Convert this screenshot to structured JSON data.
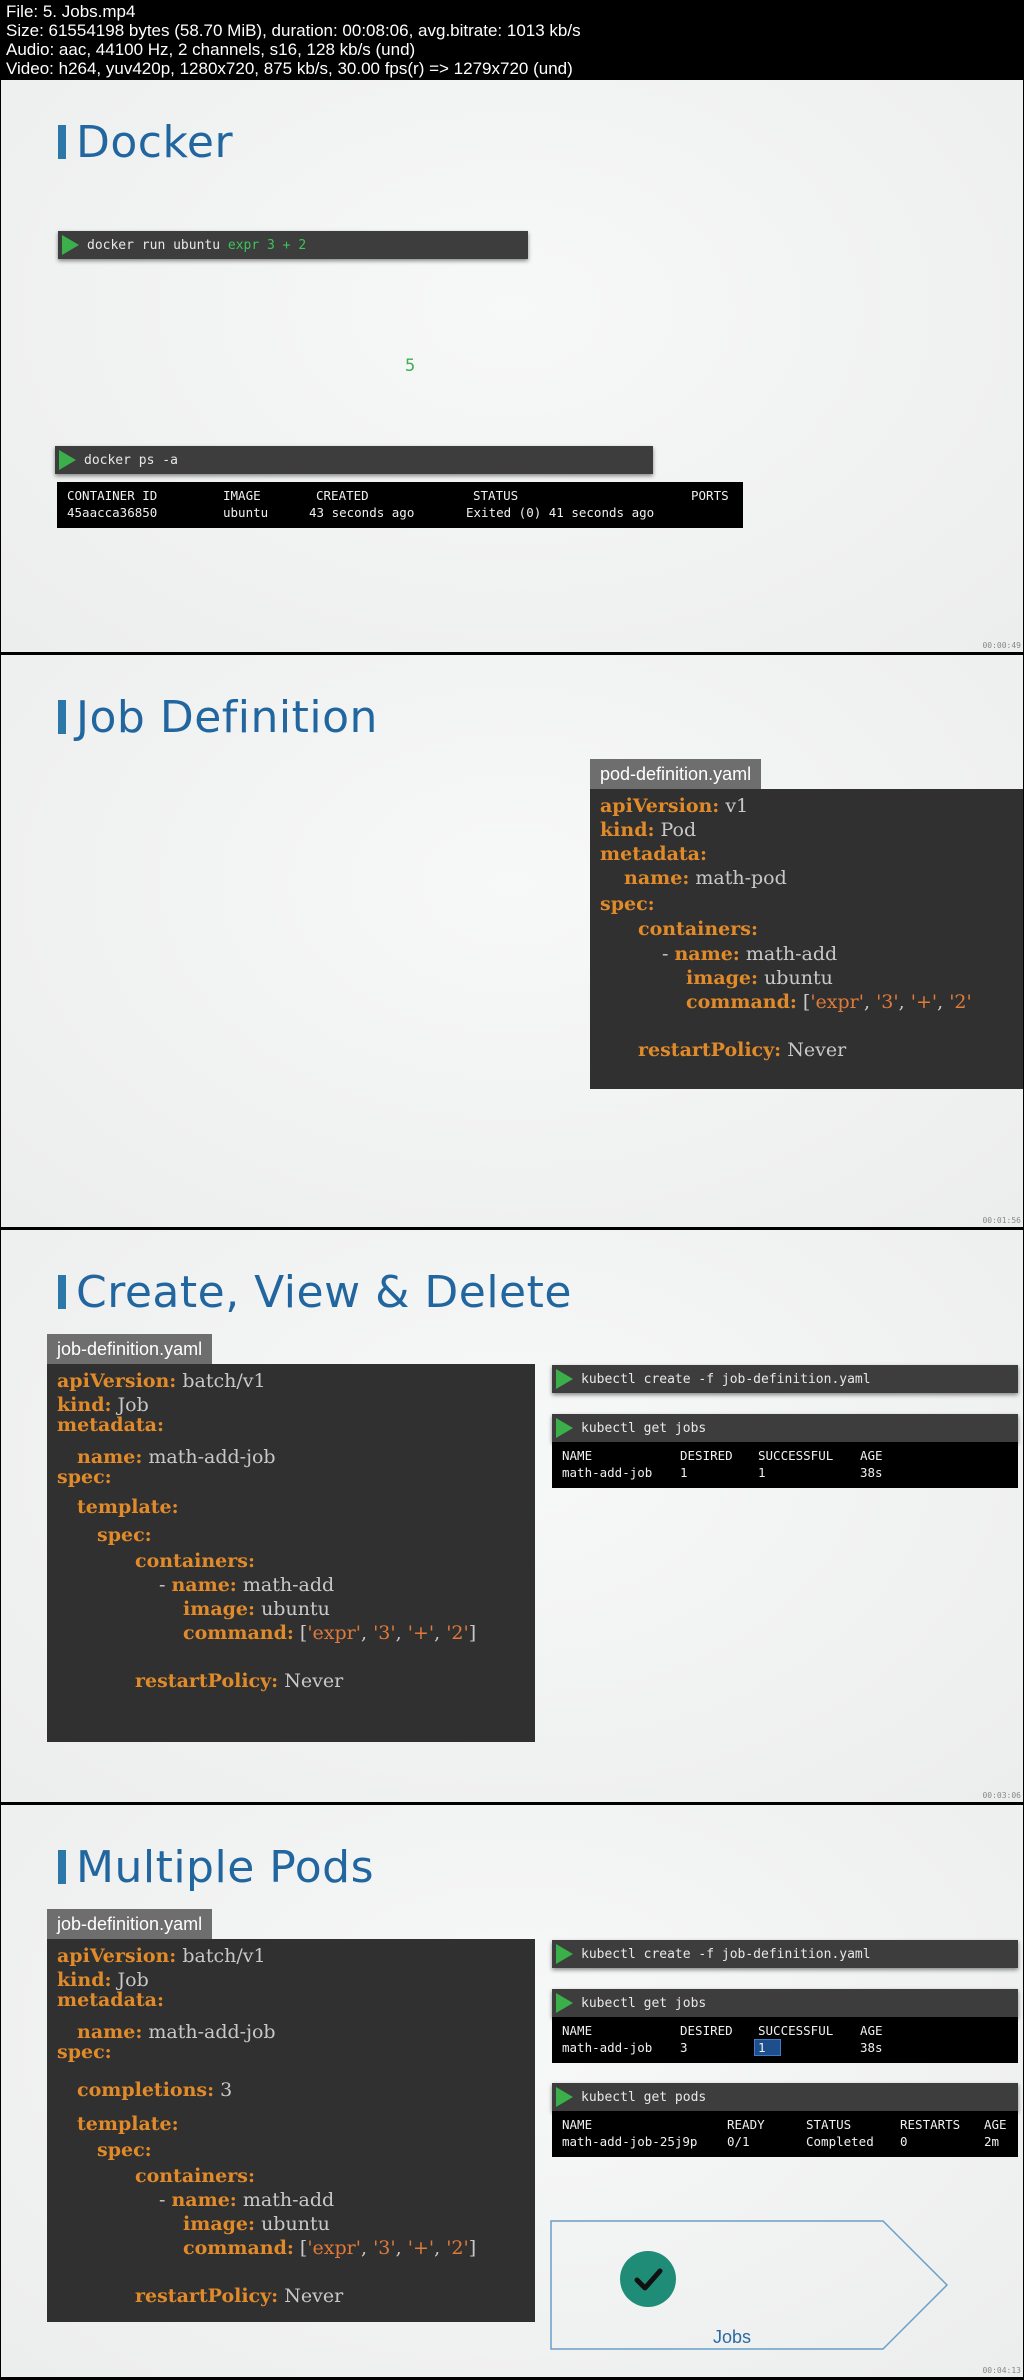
{
  "file_info": {
    "line1": "File: 5. Jobs.mp4",
    "line2": "Size: 61554198 bytes (58.70 MiB), duration: 00:08:06, avg.bitrate: 1013 kb/s",
    "line3": "Audio: aac, 44100 Hz, 2 channels, s16, 128 kb/s (und)",
    "line4": "Video: h264, yuv420p, 1280x720, 875 kb/s, 30.00 fps(r) => 1279x720 (und)"
  },
  "frame1": {
    "title": "Docker",
    "cmd1_prefix": "docker run ubuntu ",
    "cmd1_args": "expr 3 + 2",
    "result": "5",
    "cmd2": "docker ps -a",
    "ps_headers": [
      "CONTAINER ID",
      "IMAGE",
      "CREATED",
      "STATUS",
      "PORTS"
    ],
    "ps_row": [
      "45aacca36850",
      "ubuntu",
      "43 seconds ago",
      "Exited (0) 41 seconds ago",
      ""
    ],
    "timestamp": "00:00:49"
  },
  "frame2": {
    "title": "Job Definition",
    "file_tab": "pod-definition.yaml",
    "yaml": {
      "l1k": "apiVersion:",
      "l1v": " v1",
      "l2k": "kind:",
      "l2v": " Pod",
      "l3k": "metadata:",
      "l4k": "name:",
      "l4v": " math-pod",
      "l5k": "spec:",
      "l6k": "containers:",
      "l7a": "- ",
      "l7k": "name:",
      "l7v": " math-add",
      "l8k": "image:",
      "l8v": " ubuntu",
      "l9k": "command:",
      "l9a": " [",
      "l9b": "'expr'",
      "l9c": ", ",
      "l9d": "'3'",
      "l9e": ", ",
      "l9f": "'+'",
      "l9g": ", ",
      "l9h": "'2'",
      "l10k": "restartPolicy:",
      "l10v": " Never"
    },
    "timestamp": "00:01:56"
  },
  "frame3": {
    "title": "Create, View & Delete",
    "file_tab": "job-definition.yaml",
    "yaml": {
      "l1k": "apiVersion:",
      "l1v": " batch/v1",
      "l2k": "kind:",
      "l2v": " Job",
      "l3k": "metadata:",
      "l4k": "name:",
      "l4v": " math-add-job",
      "l5k": "spec:",
      "l6k": "template:",
      "l7k": "spec:",
      "l8k": "containers:",
      "l9a": "- ",
      "l9k": "name:",
      "l9v": " math-add",
      "l10k": "image:",
      "l10v": " ubuntu",
      "l11k": "command:",
      "l11a": " [",
      "l11b": "'expr'",
      "l11c": ", ",
      "l11d": "'3'",
      "l11e": ", ",
      "l11f": "'+'",
      "l11g": ", ",
      "l11h": "'2'",
      "l11i": "]",
      "l12k": "restartPolicy:",
      "l12v": " Never"
    },
    "cmd1": "kubectl create -f job-definition.yaml",
    "cmd2": "kubectl get jobs",
    "jobs_headers": [
      "NAME",
      "DESIRED",
      "SUCCESSFUL",
      "AGE"
    ],
    "jobs_row": [
      "math-add-job",
      "1",
      "1",
      "38s"
    ],
    "timestamp": "00:03:06"
  },
  "frame4": {
    "title": "Multiple Pods",
    "file_tab": "job-definition.yaml",
    "yaml": {
      "l1k": "apiVersion:",
      "l1v": " batch/v1",
      "l2k": "kind:",
      "l2v": " Job",
      "l3k": "metadata:",
      "l4k": "name:",
      "l4v": " math-add-job",
      "l5k": "spec:",
      "l6k": "completions:",
      "l6v": " 3",
      "l7k": "template:",
      "l8k": "spec:",
      "l9k": "containers:",
      "l10a": "- ",
      "l10k": "name:",
      "l10v": " math-add",
      "l11k": "image:",
      "l11v": " ubuntu",
      "l12k": "command:",
      "l12a": " [",
      "l12b": "'expr'",
      "l12c": ", ",
      "l12d": "'3'",
      "l12e": ", ",
      "l12f": "'+'",
      "l12g": ", ",
      "l12h": "'2'",
      "l12i": "]",
      "l13k": "restartPolicy:",
      "l13v": " Never"
    },
    "cmd1": "kubectl create -f job-definition.yaml",
    "cmd2": "kubectl get jobs",
    "jobs_headers": [
      "NAME",
      "DESIRED",
      "SUCCESSFUL",
      "AGE"
    ],
    "jobs_row": [
      "math-add-job",
      "3",
      "1",
      "38s"
    ],
    "cmd3": "kubectl get pods",
    "pods_headers": [
      "NAME",
      "READY",
      "STATUS",
      "RESTARTS",
      "AGE"
    ],
    "pods_row": [
      "math-add-job-25j9p",
      "0/1",
      "Completed",
      "0",
      "2m"
    ],
    "flow_label": "Jobs",
    "timestamp": "00:04:13"
  },
  "colors": {
    "title_blue": "#2266a0",
    "key_orange": "#e08a2a",
    "prompt_green": "#3bb04a",
    "check_teal": "#1f8c78"
  }
}
